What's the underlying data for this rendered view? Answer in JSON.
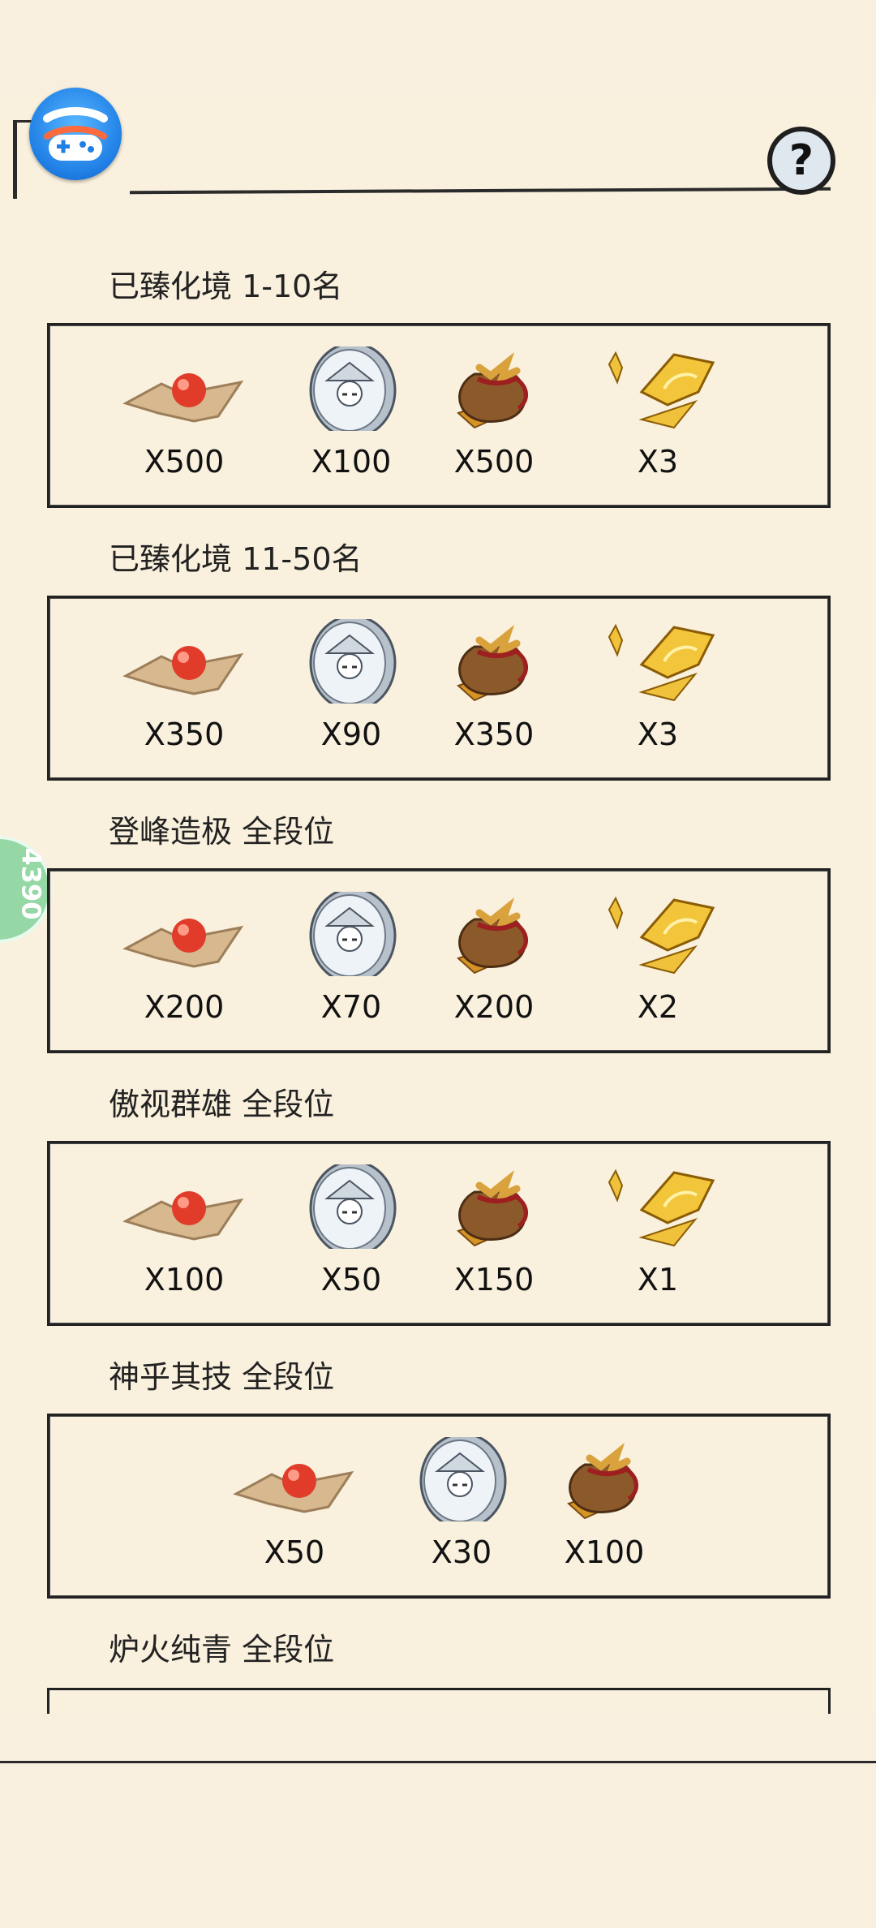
{
  "header": {
    "help_label": "?",
    "side_tab_text": "4390"
  },
  "tiers": [
    {
      "title": "已臻化境 1-10名",
      "rewards": [
        {
          "item": "red-pearl-icon",
          "qty": "X500"
        },
        {
          "item": "silver-coin-icon",
          "qty": "X100"
        },
        {
          "item": "gold-bag-icon",
          "qty": "X500"
        },
        {
          "item": "golden-shard-icon",
          "qty": "X3"
        }
      ]
    },
    {
      "title": "已臻化境 11-50名",
      "rewards": [
        {
          "item": "red-pearl-icon",
          "qty": "X350"
        },
        {
          "item": "silver-coin-icon",
          "qty": "X90"
        },
        {
          "item": "gold-bag-icon",
          "qty": "X350"
        },
        {
          "item": "golden-shard-icon",
          "qty": "X3"
        }
      ]
    },
    {
      "title": "登峰造极 全段位",
      "rewards": [
        {
          "item": "red-pearl-icon",
          "qty": "X200"
        },
        {
          "item": "silver-coin-icon",
          "qty": "X70"
        },
        {
          "item": "gold-bag-icon",
          "qty": "X200"
        },
        {
          "item": "golden-shard-icon",
          "qty": "X2"
        }
      ]
    },
    {
      "title": "傲视群雄 全段位",
      "rewards": [
        {
          "item": "red-pearl-icon",
          "qty": "X100"
        },
        {
          "item": "silver-coin-icon",
          "qty": "X50"
        },
        {
          "item": "gold-bag-icon",
          "qty": "X150"
        },
        {
          "item": "golden-shard-icon",
          "qty": "X1"
        }
      ]
    },
    {
      "title": "神乎其技 全段位",
      "rewards": [
        {
          "item": "red-pearl-icon",
          "qty": "X50"
        },
        {
          "item": "silver-coin-icon",
          "qty": "X30"
        },
        {
          "item": "gold-bag-icon",
          "qty": "X100"
        }
      ]
    },
    {
      "title": "炉火纯青 全段位",
      "rewards": []
    }
  ],
  "colors": {
    "background": "#f9f0dd",
    "box_border": "#222222",
    "side_tab": "#95d8a6",
    "logo_blue": "#1f7fe5"
  }
}
